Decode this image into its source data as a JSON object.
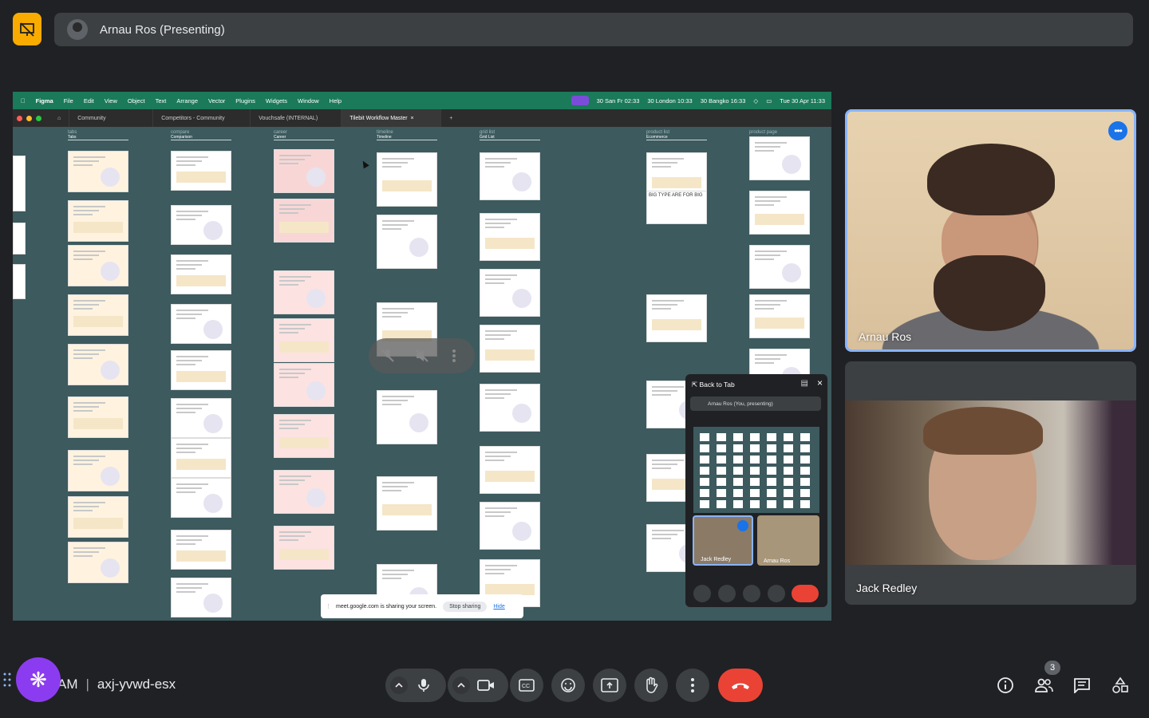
{
  "header": {
    "presenter_label": "Arnau Ros (Presenting)"
  },
  "shared_screen": {
    "menubar": {
      "app": "Figma",
      "menus": [
        "File",
        "Edit",
        "View",
        "Object",
        "Text",
        "Arrange",
        "Vector",
        "Plugins",
        "Widgets",
        "Window",
        "Help"
      ],
      "clocks": [
        "30 San Fr 02:33",
        "30 London 10:33",
        "30 Bangko 16:33"
      ],
      "datetime": "Tue 30 Apr  11:33"
    },
    "tabs": [
      "Community",
      "Competitors - Community",
      "Vouchsafe (INTERNAL)",
      "Tilebit Workflow Master"
    ],
    "columns": [
      {
        "title": "tabs",
        "sub": "Tabs"
      },
      {
        "title": "compare",
        "sub": "Comparison"
      },
      {
        "title": "career",
        "sub": "Career"
      },
      {
        "title": "timeline",
        "sub": "Timeline"
      },
      {
        "title": "grid list",
        "sub": "Grid List"
      },
      {
        "title": "product list",
        "sub": "Ecommerce"
      },
      {
        "title": "product page",
        "sub": ""
      }
    ],
    "big_type_label": "BIG TYPE ARE FOR BIG",
    "share_notice": {
      "text": "meet.google.com is sharing your screen.",
      "stop": "Stop sharing",
      "hide": "Hide"
    },
    "pip": {
      "back": "Back to Tab",
      "presenting_row": "Arnau Ros (You, presenting)",
      "tile_left": "Jack Redley",
      "tile_right": "Arnau Ros"
    }
  },
  "participants": [
    {
      "name": "Arnau Ros",
      "active": true
    },
    {
      "name": "Jack Redley",
      "active": false
    }
  ],
  "bottom": {
    "time_suffix": "AM",
    "meeting_code": "axj-yvwd-esx",
    "people_count": "3"
  },
  "colors": {
    "accent_blue": "#8ab4f8",
    "end_call_red": "#ea4335",
    "present_yellow": "#f9ab00",
    "badge_purple": "#8c3cf0"
  }
}
